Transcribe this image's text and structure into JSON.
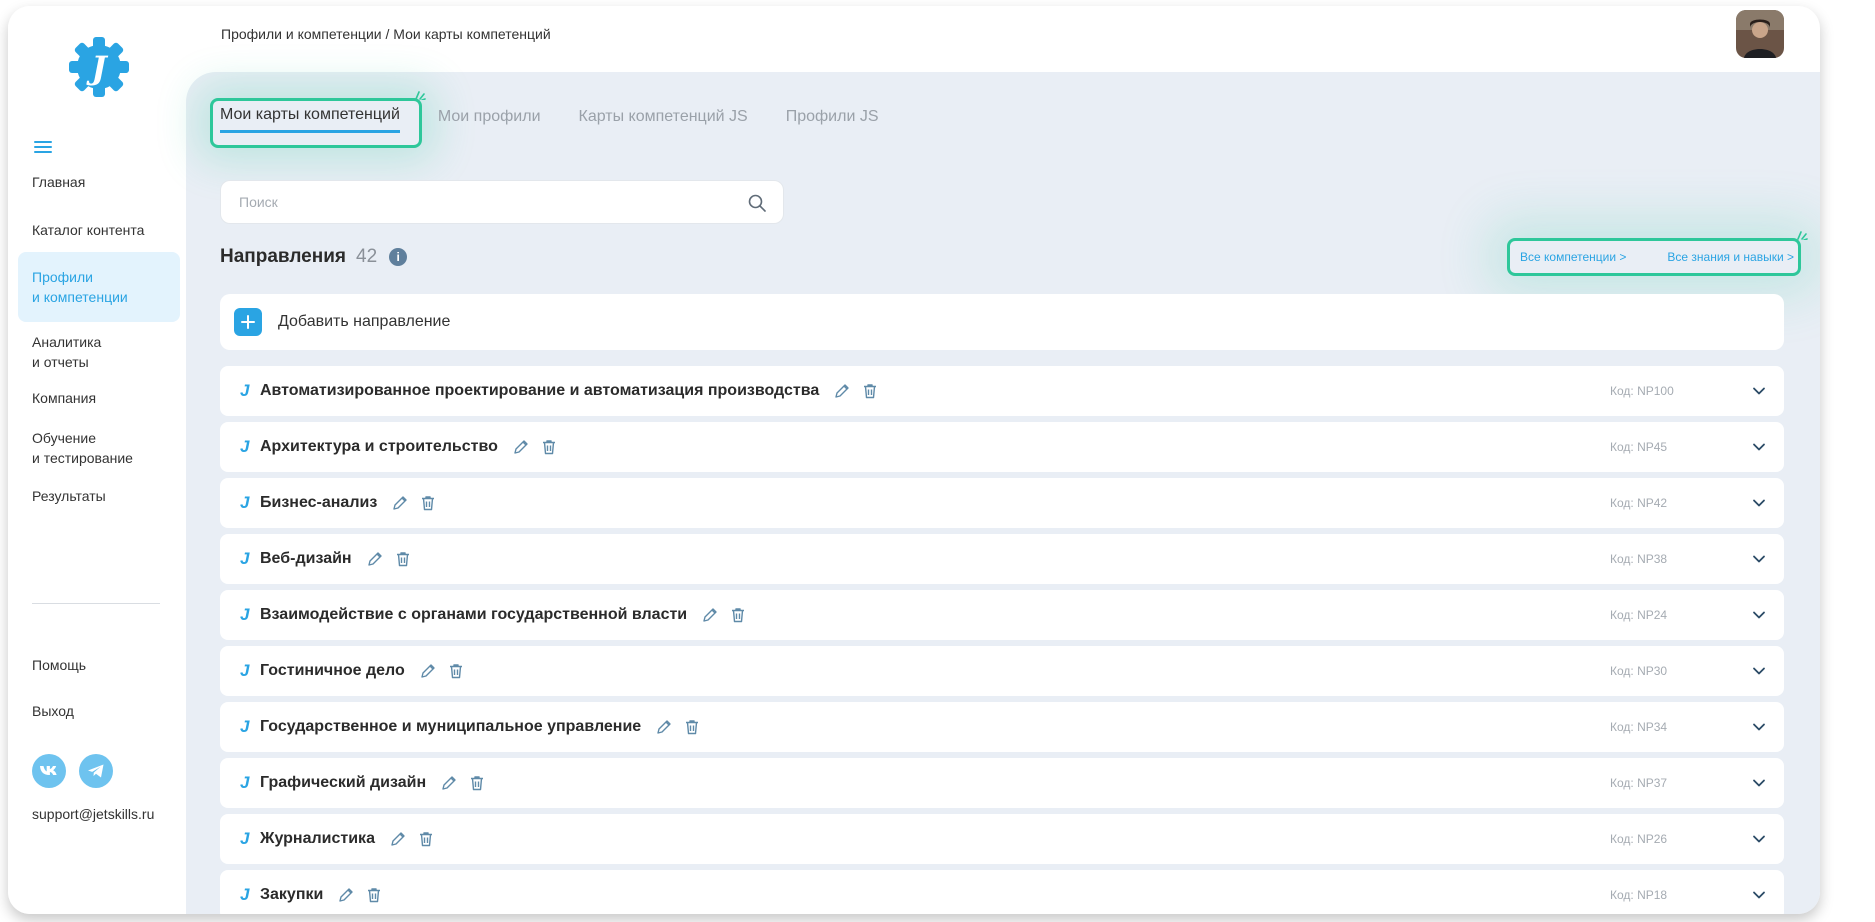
{
  "breadcrumb": "Профили и компетенции / Мои карты компетенций",
  "sidebar": {
    "items": [
      {
        "label": "Главная",
        "name": "sidebar-item-home"
      },
      {
        "label": "Каталог контента",
        "name": "sidebar-item-catalog"
      },
      {
        "label": "Профили\nи компетенции",
        "name": "sidebar-item-profiles"
      },
      {
        "label": "Аналитика\nи отчеты",
        "name": "sidebar-item-analytics"
      },
      {
        "label": "Компания",
        "name": "sidebar-item-company"
      },
      {
        "label": "Обучение\nи тестирование",
        "name": "sidebar-item-learning"
      },
      {
        "label": "Результаты",
        "name": "sidebar-item-results"
      }
    ],
    "help_label": "Помощь",
    "logout_label": "Выход",
    "support_email": "support@jetskills.ru"
  },
  "tabs": [
    {
      "label": "Мои карты компетенций",
      "active": true
    },
    {
      "label": "Мои профили",
      "active": false
    },
    {
      "label": "Карты компетенций JS",
      "active": false
    },
    {
      "label": "Профили JS",
      "active": false
    }
  ],
  "search": {
    "placeholder": "Поиск"
  },
  "directions": {
    "title": "Направления",
    "count": "42",
    "info_symbol": "i",
    "links": {
      "competencies": "Все компетенции >",
      "skills": "Все знания и навыки >"
    },
    "add_label": "Добавить направление",
    "items": [
      {
        "title": "Автоматизированное проектирование и автоматизация производства",
        "code": "Код: NP100"
      },
      {
        "title": "Архитектура и строительство",
        "code": "Код: NP45"
      },
      {
        "title": "Бизнес-анализ",
        "code": "Код: NP42"
      },
      {
        "title": "Веб-дизайн",
        "code": "Код: NP38"
      },
      {
        "title": "Взаимодействие с органами государственной власти",
        "code": "Код: NP24"
      },
      {
        "title": "Гостиничное дело",
        "code": "Код: NP30"
      },
      {
        "title": "Государственное и муниципальное управление",
        "code": "Код: NP34"
      },
      {
        "title": "Графический дизайн",
        "code": "Код: NP37"
      },
      {
        "title": "Журналистика",
        "code": "Код: NP26"
      },
      {
        "title": "Закупки",
        "code": "Код: NP18"
      }
    ]
  },
  "icons": {
    "brand_mark": "J",
    "row": [
      "j-logo-icon",
      "pencil-icon",
      "trash-icon",
      "chevron-down-icon"
    ]
  },
  "colors": {
    "accent": "#2aa4e3",
    "highlight": "#2ec79a",
    "panel": "#e9eef5"
  }
}
